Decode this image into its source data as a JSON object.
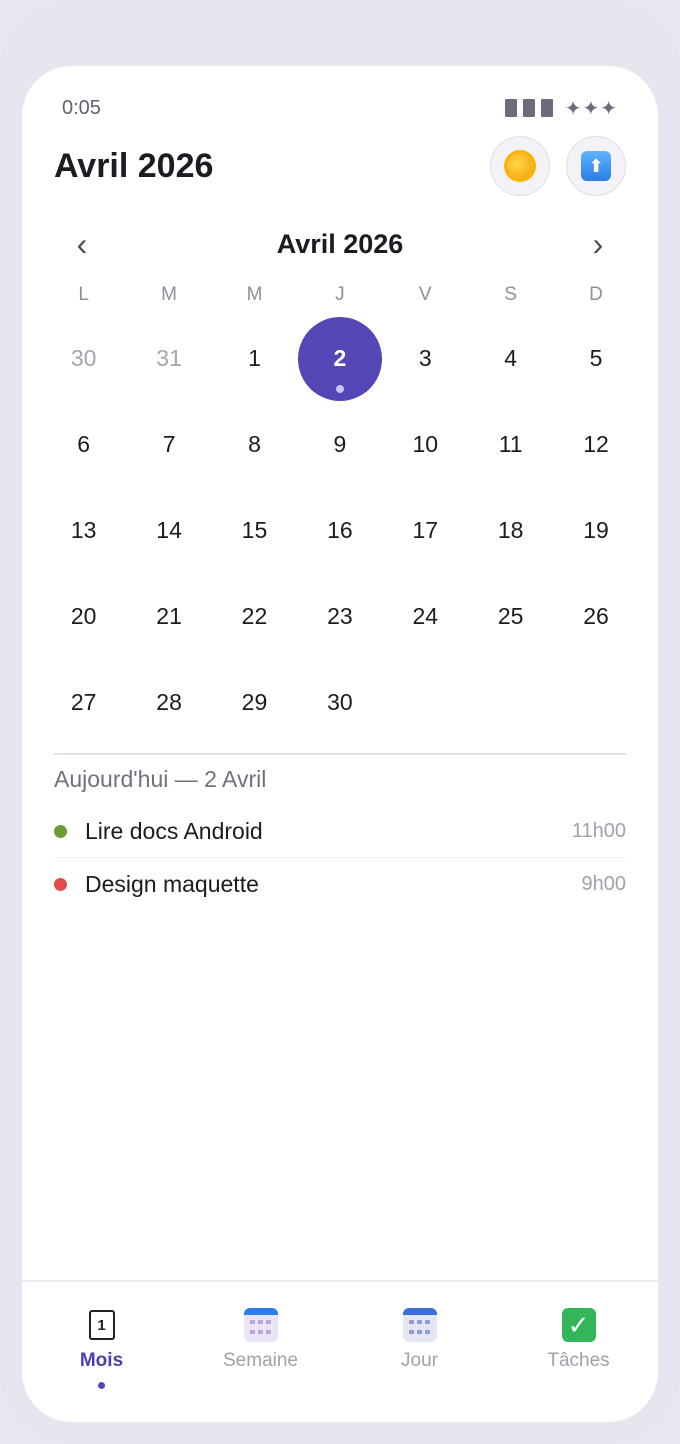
{
  "status_bar": {
    "time": "0:05",
    "signal_glyph": "✦✦✦"
  },
  "header": {
    "title": "Avril 2026",
    "theme_icon": "sun-icon",
    "share_icon": "upload-icon"
  },
  "calendar": {
    "month_label": "Avril 2026",
    "prev_glyph": "‹",
    "next_glyph": "›",
    "weekdays": [
      "L",
      "M",
      "M",
      "J",
      "V",
      "S",
      "D"
    ],
    "days": [
      "30",
      "31",
      "1",
      "2",
      "3",
      "4",
      "5",
      "6",
      "7",
      "8",
      "9",
      "10",
      "11",
      "12",
      "13",
      "14",
      "15",
      "16",
      "17",
      "18",
      "19",
      "20",
      "21",
      "22",
      "23",
      "24",
      "25",
      "26",
      "27",
      "28",
      "29",
      "30"
    ],
    "muted_days": [
      0,
      1
    ],
    "selected_index": 3,
    "selected_color": "#5446b5"
  },
  "today": {
    "title": "Aujourd'hui — 2 Avril",
    "events": [
      {
        "title": "Lire docs Android",
        "time": "11h00",
        "color": "#6a9c2f"
      },
      {
        "title": "Design maquette",
        "time": "9h00",
        "color": "#e14b4b"
      }
    ]
  },
  "bottom_nav": {
    "tabs": [
      {
        "label": "Mois",
        "icon": "calendar-page-icon",
        "active": true
      },
      {
        "label": "Semaine",
        "icon": "calendar-grid-icon",
        "active": false
      },
      {
        "label": "Jour",
        "icon": "spiral-calendar-icon",
        "active": false
      },
      {
        "label": "Tâches",
        "icon": "checkmark-icon",
        "active": false
      }
    ]
  }
}
